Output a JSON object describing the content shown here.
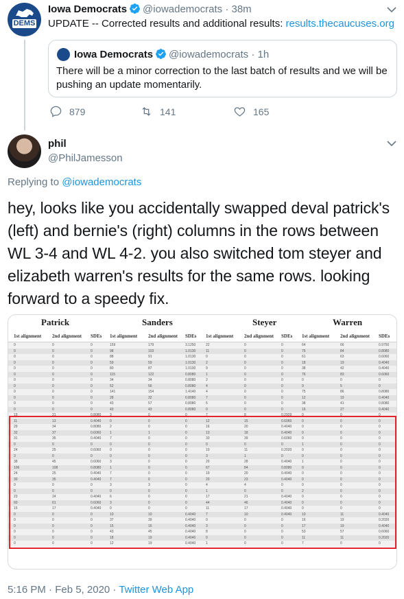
{
  "parent_tweet": {
    "avatar_text": "DEMS",
    "name": "Iowa Democrats",
    "handle": "@iowademocrats",
    "separator": "·",
    "time": "38m",
    "text": "UPDATE -- Corrected results and additional results: ",
    "link": "results.thecaucuses.org",
    "quoted": {
      "name": "Iowa Democrats",
      "handle": "@iowademocrats",
      "separator": "·",
      "time": "1h",
      "text": "There will be a minor correction to the last batch of results and we will be pushing an update momentarily."
    },
    "actions": {
      "replies": "879",
      "retweets": "141",
      "likes": "165"
    }
  },
  "reply_tweet": {
    "name": "phil",
    "handle": "@PhilJamesson",
    "replying_prefix": "Replying to ",
    "replying_to": "@iowademocrats",
    "text": "hey, looks like you accidentally swapped deval patrick's (left) and bernie's (right) columns in the rows between WL 3-4 and WL 4-2. you also switched tom steyer and elizabeth warren's results for the same rows. looking forward to a speedy fix."
  },
  "results_table": {
    "candidates": [
      "Patrick",
      "Sanders",
      "Steyer",
      "Warren"
    ],
    "sub_headers": [
      "1st alignment",
      "2nd alignment",
      "SDEs"
    ],
    "rows": [
      [
        "0",
        "0",
        "0",
        "159",
        "179",
        "3.1250",
        "22",
        "0",
        "0",
        "64",
        "66",
        "0.9750"
      ],
      [
        "0",
        "0",
        "0",
        "98",
        "103",
        "1.0130",
        "11",
        "0",
        "0",
        "75",
        "84",
        "0.8080"
      ],
      [
        "0",
        "0",
        "0",
        "88",
        "91",
        "1.0130",
        "0",
        "0",
        "0",
        "61",
        "63",
        "0.6060"
      ],
      [
        "0",
        "0",
        "0",
        "59",
        "59",
        "1.0130",
        "2",
        "0",
        "0",
        "18",
        "19",
        "0.4040"
      ],
      [
        "0",
        "0",
        "0",
        "80",
        "87",
        "1.0100",
        "9",
        "0",
        "0",
        "38",
        "42",
        "0.4040"
      ],
      [
        "0",
        "0",
        "0",
        "115",
        "122",
        "0.8080",
        "1",
        "0",
        "0",
        "76",
        "83",
        "0.6060"
      ],
      [
        "0",
        "0",
        "0",
        "34",
        "34",
        "0.8080",
        "2",
        "0",
        "0",
        "0",
        "0",
        "0"
      ],
      [
        "0",
        "0",
        "0",
        "52",
        "56",
        "0.8080",
        "4",
        "0",
        "0",
        "9",
        "5",
        "0"
      ],
      [
        "0",
        "0",
        "0",
        "141",
        "154",
        "1.4140",
        "4",
        "0",
        "0",
        "75",
        "86",
        "0.8080"
      ],
      [
        "0",
        "0",
        "0",
        "28",
        "32",
        "0.8080",
        "7",
        "0",
        "0",
        "12",
        "19",
        "0.4040"
      ],
      [
        "0",
        "0",
        "0",
        "43",
        "57",
        "0.8080",
        "5",
        "0",
        "0",
        "38",
        "41",
        "0.8080"
      ],
      [
        "0",
        "0",
        "0",
        "43",
        "43",
        "0.8080",
        "0",
        "0",
        "0",
        "16",
        "27",
        "0.4040"
      ],
      [
        "19",
        "21",
        "0.8080",
        "3",
        "0",
        "0",
        "7",
        "8",
        "0.2929",
        "0",
        "0",
        "0"
      ],
      [
        "11",
        "13",
        "0.4040",
        "0",
        "0",
        "0",
        "12",
        "15",
        "0.6060",
        "0",
        "0",
        "0"
      ],
      [
        "29",
        "34",
        "0.8080",
        "2",
        "0",
        "0",
        "16",
        "20",
        "0.4040",
        "0",
        "0",
        "0"
      ],
      [
        "32",
        "37",
        "0.6060",
        "1",
        "1",
        "0",
        "13",
        "18",
        "0.4040",
        "0",
        "0",
        "0"
      ],
      [
        "31",
        "35",
        "0.4040",
        "7",
        "0",
        "0",
        "33",
        "39",
        "0.6060",
        "0",
        "0",
        "0"
      ],
      [
        "0",
        "0",
        "0",
        "0",
        "0",
        "0",
        "0",
        "0",
        "0",
        "1",
        "0",
        "0"
      ],
      [
        "24",
        "25",
        "0.6060",
        "0",
        "0",
        "0",
        "10",
        "11",
        "0.2020",
        "0",
        "0",
        "0"
      ],
      [
        "3",
        "0",
        "0",
        "0",
        "0",
        "0",
        "3",
        "1",
        "0",
        "0",
        "0",
        "0"
      ],
      [
        "38",
        "45",
        "0.6060",
        "3",
        "0",
        "0",
        "20",
        "28",
        "0.4040",
        "1",
        "0",
        "0"
      ],
      [
        "106",
        "108",
        "0.8080",
        "1",
        "0",
        "0",
        "67",
        "84",
        "0.8080",
        "0",
        "0",
        "0"
      ],
      [
        "24",
        "25",
        "0.4040",
        "7",
        "0",
        "0",
        "19",
        "20",
        "0.4040",
        "0",
        "0",
        "0"
      ],
      [
        "30",
        "35",
        "0.4040",
        "7",
        "0",
        "0",
        "20",
        "23",
        "0.4040",
        "0",
        "0",
        "0"
      ],
      [
        "0",
        "0",
        "0",
        "3",
        "3",
        "0",
        "4",
        "4",
        "0",
        "0",
        "0",
        "0"
      ],
      [
        "0",
        "0",
        "0",
        "0",
        "0",
        "0",
        "1",
        "0",
        "0",
        "2",
        "0",
        "0"
      ],
      [
        "23",
        "24",
        "0.4040",
        "6",
        "0",
        "0",
        "17",
        "21",
        "0.4040",
        "0",
        "0",
        "0"
      ],
      [
        "60",
        "61",
        "0.6060",
        "3",
        "0",
        "0",
        "44",
        "46",
        "0.4040",
        "0",
        "0",
        "0"
      ],
      [
        "15",
        "17",
        "0.4040",
        "0",
        "0",
        "0",
        "11",
        "17",
        "0.4040",
        "0",
        "0",
        "0"
      ],
      [
        "0",
        "0",
        "0",
        "10",
        "10",
        "0.4040",
        "7",
        "10",
        "0.4040",
        "10",
        "11",
        "0.4040"
      ],
      [
        "0",
        "0",
        "0",
        "37",
        "39",
        "0.4040",
        "0",
        "0",
        "0",
        "16",
        "19",
        "0.2020"
      ],
      [
        "0",
        "0",
        "0",
        "15",
        "16",
        "0.4040",
        "3",
        "0",
        "0",
        "17",
        "19",
        "0.4040"
      ],
      [
        "0",
        "0",
        "0",
        "43",
        "45",
        "0.4040",
        "8",
        "0",
        "0",
        "53",
        "57",
        "0.6060"
      ],
      [
        "0",
        "0",
        "0",
        "18",
        "19",
        "0.4040",
        "0",
        "0",
        "0",
        "11",
        "11",
        "0.2020"
      ],
      [
        "0",
        "0",
        "0",
        "12",
        "19",
        "0.4040",
        "1",
        "0",
        "0",
        "7",
        "0",
        "0"
      ]
    ]
  },
  "footer": {
    "timestamp": "5:16 PM · Feb 5, 2020 · ",
    "app": "Twitter Web App"
  },
  "colors": {
    "accent": "#1b95e0",
    "muted": "#657786",
    "highlight": "#e0242a"
  }
}
